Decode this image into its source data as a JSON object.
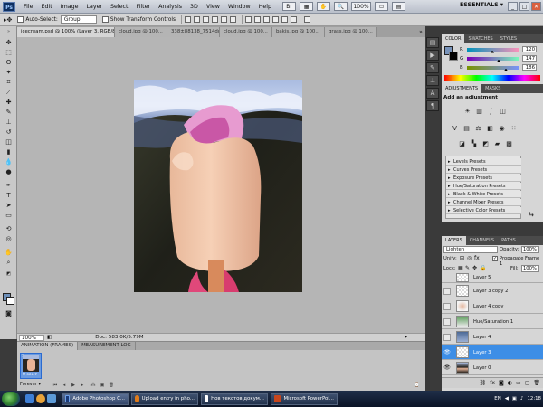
{
  "menubar": {
    "logo": "Ps",
    "items": [
      "File",
      "Edit",
      "Image",
      "Layer",
      "Select",
      "Filter",
      "Analysis",
      "3D",
      "View",
      "Window",
      "Help"
    ],
    "zoom": "100%",
    "workspace": "ESSENTIALS ▾",
    "win_controls": [
      "_",
      "□",
      "✕"
    ]
  },
  "options": {
    "auto_select_label": "Auto-Select:",
    "auto_select_value": "Group",
    "show_transform_label": "Show Transform Controls"
  },
  "tabs": [
    {
      "label": "icecream.psd @ 100% (Layer 3, RGB/8#) *",
      "active": true
    },
    {
      "label": "cloud.jpg @ 100..."
    },
    {
      "label": "338±88138_7514dd8e0fe.jpg @ 100..."
    },
    {
      "label": "cloud.jpg @ 100..."
    },
    {
      "label": "bakis.jpg @ 100..."
    },
    {
      "label": "grass.jpg @ 100..."
    }
  ],
  "status": {
    "zoom": "100%",
    "doc": "Doc: 583.0K/5.79M"
  },
  "animation": {
    "tabs": [
      "ANIMATION (FRAMES)",
      "MEASUREMENT LOG"
    ],
    "frame_number": "1",
    "frame_time": "0 sec.▾",
    "loop": "Forever ▾"
  },
  "color_panel": {
    "tabs": [
      "COLOR",
      "SWATCHES",
      "STYLES"
    ],
    "r_label": "R",
    "g_label": "G",
    "b_label": "B",
    "r": "120",
    "g": "147",
    "b": "186",
    "fg_color": "#7893ba"
  },
  "adjustments": {
    "tabs": [
      "ADJUSTMENTS",
      "MASKS"
    ],
    "header": "Add an adjustment",
    "presets": [
      "Levels Presets",
      "Curves Presets",
      "Exposure Presets",
      "Hue/Saturation Presets",
      "Black & White Presets",
      "Channel Mixer Presets",
      "Selective Color Presets"
    ]
  },
  "layers": {
    "tabs": [
      "LAYERS",
      "CHANNELS",
      "PATHS"
    ],
    "blend_mode": "Lighten",
    "opacity_label": "Opacity:",
    "opacity": "100%",
    "unify_label": "Unify:",
    "propagate_label": "Propagate Frame 1",
    "lock_label": "Lock:",
    "fill_label": "Fill:",
    "fill": "100%",
    "items": [
      {
        "name": "Layer 5",
        "visible": false,
        "selected": false
      },
      {
        "name": "Layer 3 copy 2",
        "visible": false,
        "selected": false
      },
      {
        "name": "Layer 4 copy",
        "visible": false,
        "selected": false
      },
      {
        "name": "Hue/Saturation 1",
        "visible": false,
        "selected": false
      },
      {
        "name": "Layer 4",
        "visible": false,
        "selected": false
      },
      {
        "name": "Layer 3",
        "visible": true,
        "selected": true
      },
      {
        "name": "Layer 0",
        "visible": true,
        "selected": false
      }
    ]
  },
  "taskbar": {
    "tasks": [
      {
        "label": "Adobe Photoshop C...",
        "active": true,
        "color": "#1a3a78"
      },
      {
        "label": "Upload entry in pho...",
        "active": false,
        "color": "#e07b1a"
      },
      {
        "label": "Нов текстов докум...",
        "active": false,
        "color": "#ffffff"
      },
      {
        "label": "Microsoft PowerPoi...",
        "active": false,
        "color": "#c8461c"
      }
    ],
    "lang": "EN",
    "time": "12:18"
  }
}
